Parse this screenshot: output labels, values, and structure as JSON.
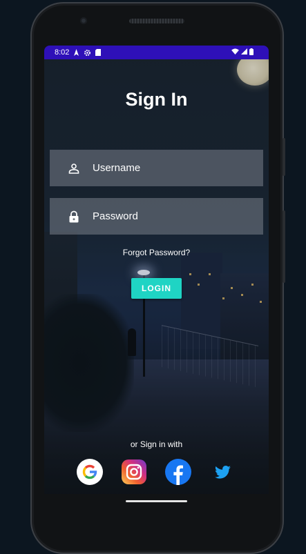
{
  "status_bar": {
    "time": "8:02",
    "icons": [
      "navigation-icon",
      "settings-gear-icon",
      "sd-card-icon",
      "wifi-icon",
      "cell-signal-icon",
      "battery-icon"
    ]
  },
  "screen": {
    "title": "Sign In",
    "username": {
      "placeholder": "Username",
      "icon": "person-icon"
    },
    "password": {
      "placeholder": "Password",
      "icon": "lock-icon"
    },
    "forgot_password": "Forgot Password?",
    "login_label": "LOGIN",
    "alt_sign_in_label": "or Sign in with",
    "social_providers": [
      "google",
      "instagram",
      "facebook",
      "twitter"
    ]
  },
  "colors": {
    "status_bar": "#2e10b8",
    "login_button": "#1fd4c4",
    "facebook": "#1877f2",
    "twitter": "#1da1f2"
  }
}
